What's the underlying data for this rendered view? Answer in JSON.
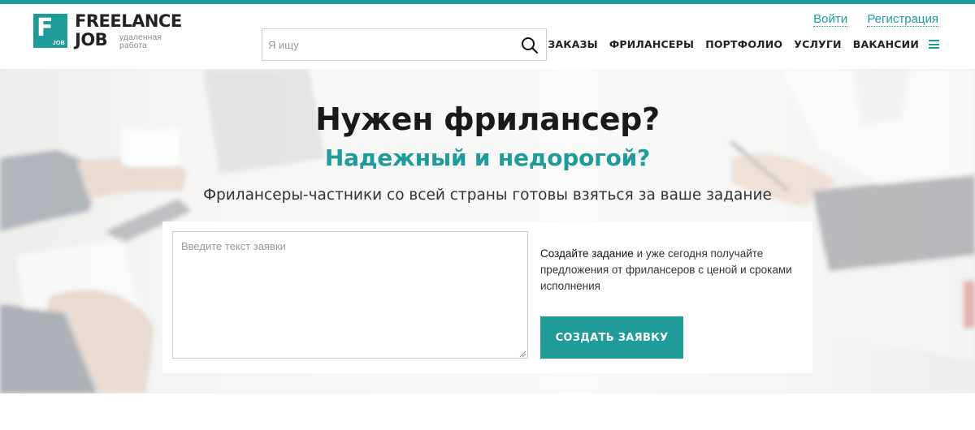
{
  "header": {
    "logo": {
      "line1": "FREELANCE",
      "line2": "JOB",
      "mark_letter": "F",
      "mark_small": "JOB",
      "tagline": "удаленная работа"
    },
    "search": {
      "placeholder": "Я ищу",
      "icon": "search-icon"
    },
    "auth": {
      "login": "Войти",
      "register": "Регистрация"
    },
    "nav": [
      {
        "label": "ЗАКАЗЫ"
      },
      {
        "label": "ФРИЛАНСЕРЫ"
      },
      {
        "label": "ПОРТФОЛИО"
      },
      {
        "label": "УСЛУГИ"
      },
      {
        "label": "ВАКАНСИИ"
      }
    ],
    "menu_icon": "hamburger-menu-icon"
  },
  "hero": {
    "title": "Нужен фрилансер?",
    "subtitle": "Надежный и недорогой?",
    "lead": "Фрилансеры-частники со всей страны готовы взяться за ваше задание",
    "form": {
      "textarea_placeholder": "Введите текст заявки",
      "info_strong": "Создайте задание",
      "info_rest": " и уже сегодня получайте предложения от фрилансеров с ценой и сроками исполнения",
      "button_label": "СОЗДАТЬ ЗАЯВКУ"
    }
  },
  "colors": {
    "accent": "#1f9c9a",
    "text": "#222222",
    "background": "#ffffff"
  }
}
